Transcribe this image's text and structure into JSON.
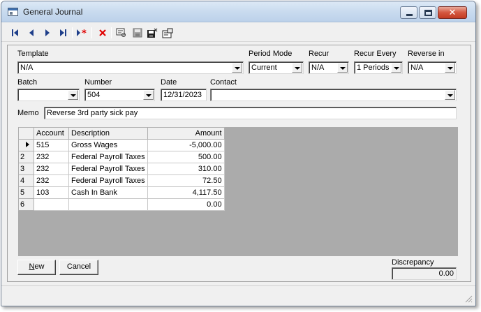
{
  "window": {
    "title": "General Journal"
  },
  "colors": {
    "red_icon": "#e00000",
    "nav_blue": "#1f3f8a",
    "grid_bg": "#ababab",
    "close_button": "#c94a33"
  },
  "toolbar": {
    "icons": [
      "first-record-icon",
      "previous-record-icon",
      "next-record-icon",
      "last-record-icon",
      "new-record-icon",
      "delete-icon",
      "find-icon",
      "save-icon",
      "save-close-icon",
      "properties-icon"
    ]
  },
  "form": {
    "template": {
      "label": "Template",
      "value": "N/A"
    },
    "period_mode": {
      "label": "Period Mode",
      "value": "Current"
    },
    "recur": {
      "label": "Recur",
      "value": "N/A"
    },
    "recur_every": {
      "label": "Recur Every",
      "value": "1 Periods"
    },
    "reverse_in": {
      "label": "Reverse in",
      "value": "N/A"
    },
    "batch": {
      "label": "Batch",
      "value": ""
    },
    "number": {
      "label": "Number",
      "value": "504"
    },
    "date": {
      "label": "Date",
      "value": "12/31/2023"
    },
    "contact": {
      "label": "Contact",
      "value": ""
    },
    "memo": {
      "label": "Memo",
      "value": "Reverse 3rd party sick pay"
    }
  },
  "grid": {
    "columns": [
      "Account",
      "Description",
      "Amount"
    ],
    "rows": [
      {
        "row": "",
        "account": "515",
        "description": "Gross Wages",
        "amount": "-5,000.00"
      },
      {
        "row": "2",
        "account": "232",
        "description": "Federal Payroll Taxes",
        "amount": "500.00"
      },
      {
        "row": "3",
        "account": "232",
        "description": "Federal Payroll Taxes",
        "amount": "310.00"
      },
      {
        "row": "4",
        "account": "232",
        "description": "Federal Payroll Taxes",
        "amount": "72.50"
      },
      {
        "row": "5",
        "account": "103",
        "description": "Cash In Bank",
        "amount": "4,117.50"
      },
      {
        "row": "6",
        "account": "",
        "description": "",
        "amount": "0.00"
      }
    ]
  },
  "buttons": {
    "new_hotkey": "N",
    "new_rest": "ew",
    "cancel": "Cancel"
  },
  "discrepancy": {
    "label": "Discrepancy",
    "value": "0.00"
  }
}
